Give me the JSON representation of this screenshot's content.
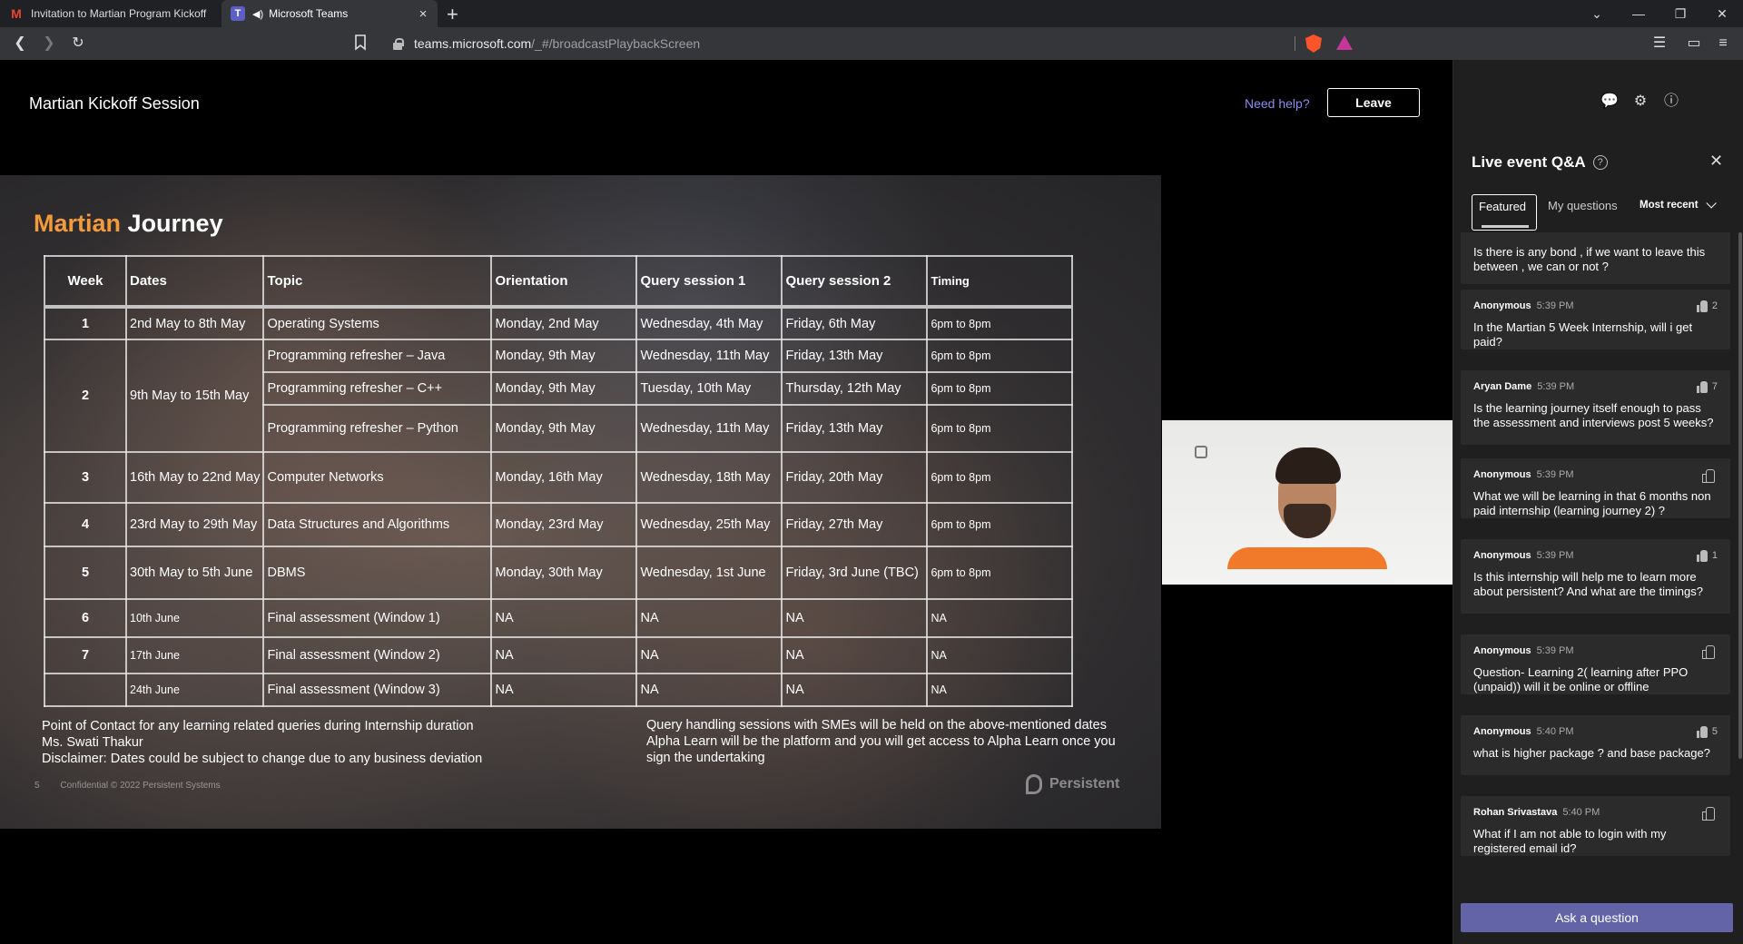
{
  "browser": {
    "tabs": [
      {
        "title": "Invitation to Martian Program Kickoff",
        "icon": "gmail-icon"
      },
      {
        "title": "Microsoft Teams",
        "icon": "teams-icon",
        "active": true
      }
    ],
    "new_tab": "+",
    "url_host": "teams.microsoft.com",
    "url_path": "/_#/broadcastPlaybackScreen"
  },
  "header": {
    "title": "Martian Kickoff Session",
    "need_help": "Need help?",
    "leave": "Leave"
  },
  "slide": {
    "title_accent": "Martian",
    "title_rest": "Journey",
    "columns": [
      "Week",
      "Dates",
      "Topic",
      "Orientation",
      "Query session 1",
      "Query session 2",
      "Timing"
    ],
    "rows": [
      {
        "week": "1",
        "dates": "2nd May to 8th May",
        "topic": "Operating Systems",
        "orientation": "Monday, 2nd May",
        "q1": "Wednesday, 4th May",
        "q2": "Friday, 6th May",
        "timing": "6pm to 8pm"
      },
      {
        "week": "2",
        "dates": "9th May to 15th May",
        "topic": "Programming refresher – Java",
        "orientation": "Monday, 9th May",
        "q1": "Wednesday, 11th May",
        "q2": "Friday, 13th May",
        "timing": "6pm to 8pm"
      },
      {
        "topic": "Programming refresher – C++",
        "orientation": "Monday, 9th May",
        "q1": "Tuesday, 10th May",
        "q2": "Thursday, 12th May",
        "timing": "6pm to 8pm"
      },
      {
        "topic": "Programming refresher – Python",
        "orientation": "Monday, 9th May",
        "q1": "Wednesday, 11th May",
        "q2": "Friday, 13th May",
        "timing": "6pm to 8pm"
      },
      {
        "week": "3",
        "dates": "16th May to 22nd May",
        "topic": "Computer Networks",
        "orientation": "Monday, 16th May",
        "q1": "Wednesday, 18th May",
        "q2": "Friday, 20th May",
        "timing": "6pm to 8pm"
      },
      {
        "week": "4",
        "dates": "23rd May to 29th May",
        "topic": "Data Structures and Algorithms",
        "orientation": "Monday, 23rd May",
        "q1": "Wednesday, 25th May",
        "q2": "Friday, 27th May",
        "timing": "6pm to 8pm"
      },
      {
        "week": "5",
        "dates": "30th May to 5th June",
        "topic": "DBMS",
        "orientation": "Monday, 30th May",
        "q1": "Wednesday, 1st June",
        "q2": "Friday, 3rd June (TBC)",
        "timing": "6pm to 8pm"
      },
      {
        "week": "6",
        "dates": "10th June",
        "topic": "Final assessment (Window 1)",
        "orientation": "NA",
        "q1": "NA",
        "q2": "NA",
        "timing": "NA"
      },
      {
        "week": "7",
        "dates": "17th June",
        "topic": "Final assessment (Window 2)",
        "orientation": "NA",
        "q1": "NA",
        "q2": "NA",
        "timing": "NA"
      },
      {
        "week": "",
        "dates": "24th June",
        "topic": "Final assessment (Window 3)",
        "orientation": "NA",
        "q1": "NA",
        "q2": "NA",
        "timing": "NA"
      }
    ],
    "notes_left": [
      "Point of Contact for any learning related queries during Internship duration",
      "Ms. Swati Thakur",
      "Disclaimer: Dates could be subject to change due to any business deviation"
    ],
    "notes_right": [
      "Query handling sessions with SMEs  will be held on the above-mentioned dates",
      "Alpha Learn will be the platform and you will get access to Alpha Learn once you",
      "sign the undertaking"
    ],
    "footer_page": "5",
    "footer_confidential": "Confidential © 2022 Persistent Systems",
    "footer_logo": "Persistent"
  },
  "qa": {
    "title": "Live event Q&A",
    "tabs": [
      "Featured",
      "My questions"
    ],
    "sort": "Most recent",
    "items": [
      {
        "author": "",
        "time": "",
        "likes": "",
        "text": "Is there is any bond , if we want to leave this between , we can or not ?"
      },
      {
        "author": "Anonymous",
        "time": "5:39 PM",
        "likes": "2",
        "text": "In the Martian 5 Week Internship, will i get paid?"
      },
      {
        "author": "Aryan Dame",
        "time": "5:39 PM",
        "likes": "7",
        "text": "Is the learning journey itself enough to pass the assessment and interviews post 5 weeks?"
      },
      {
        "author": "Anonymous",
        "time": "5:39 PM",
        "likes": "",
        "text": "What we will be learning in that 6 months non paid internship (learning journey 2) ?"
      },
      {
        "author": "Anonymous",
        "time": "5:39 PM",
        "likes": "1",
        "text": "Is this internship will help me to learn more about persistent? And what are the timings?"
      },
      {
        "author": "Anonymous",
        "time": "5:39 PM",
        "likes": "",
        "text": "Question- Learning 2( learning after PPO (unpaid)) will it be online or offline"
      },
      {
        "author": "Anonymous",
        "time": "5:40 PM",
        "likes": "5",
        "text": "what is higher package ? and base package?"
      },
      {
        "author": "Rohan Srivastava",
        "time": "5:40 PM",
        "likes": "",
        "text": "What if I am not able to login with my registered email id?"
      }
    ],
    "ask": "Ask a question"
  },
  "colors": {
    "accent": "#f39a3c",
    "teams_purple": "#6264a7",
    "link": "#8b8cf0"
  }
}
